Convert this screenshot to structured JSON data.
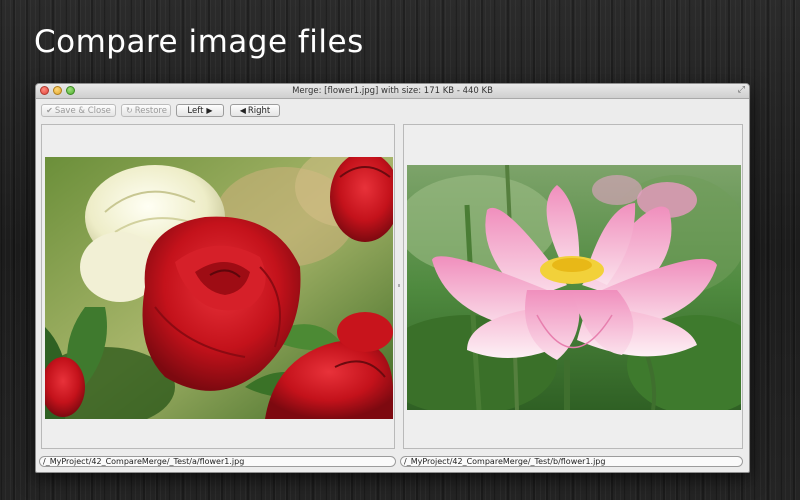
{
  "headline": "Compare image files",
  "window": {
    "title": "Merge: [flower1.jpg] with size: 171 KB - 440 KB"
  },
  "toolbar": {
    "save_close": "Save & Close",
    "restore": "Restore",
    "left": "Left",
    "right": "Right"
  },
  "icons": {
    "save": "checkmark-icon",
    "restore": "refresh-icon",
    "left": "play-right-icon",
    "right": "play-left-icon"
  },
  "panes": {
    "left": {
      "path": "/_MyProject/42_CompareMerge/_Test/a/flower1.jpg",
      "image": "red-white-roses"
    },
    "right": {
      "path": "/_MyProject/42_CompareMerge/_Test/b/flower1.jpg",
      "image": "pink-lotus"
    }
  },
  "colors": {
    "window_bg": "#ececec",
    "rose_red": "#c8141c",
    "lotus_pink": "#f2a6c6",
    "foliage": "#3f7a2e"
  }
}
